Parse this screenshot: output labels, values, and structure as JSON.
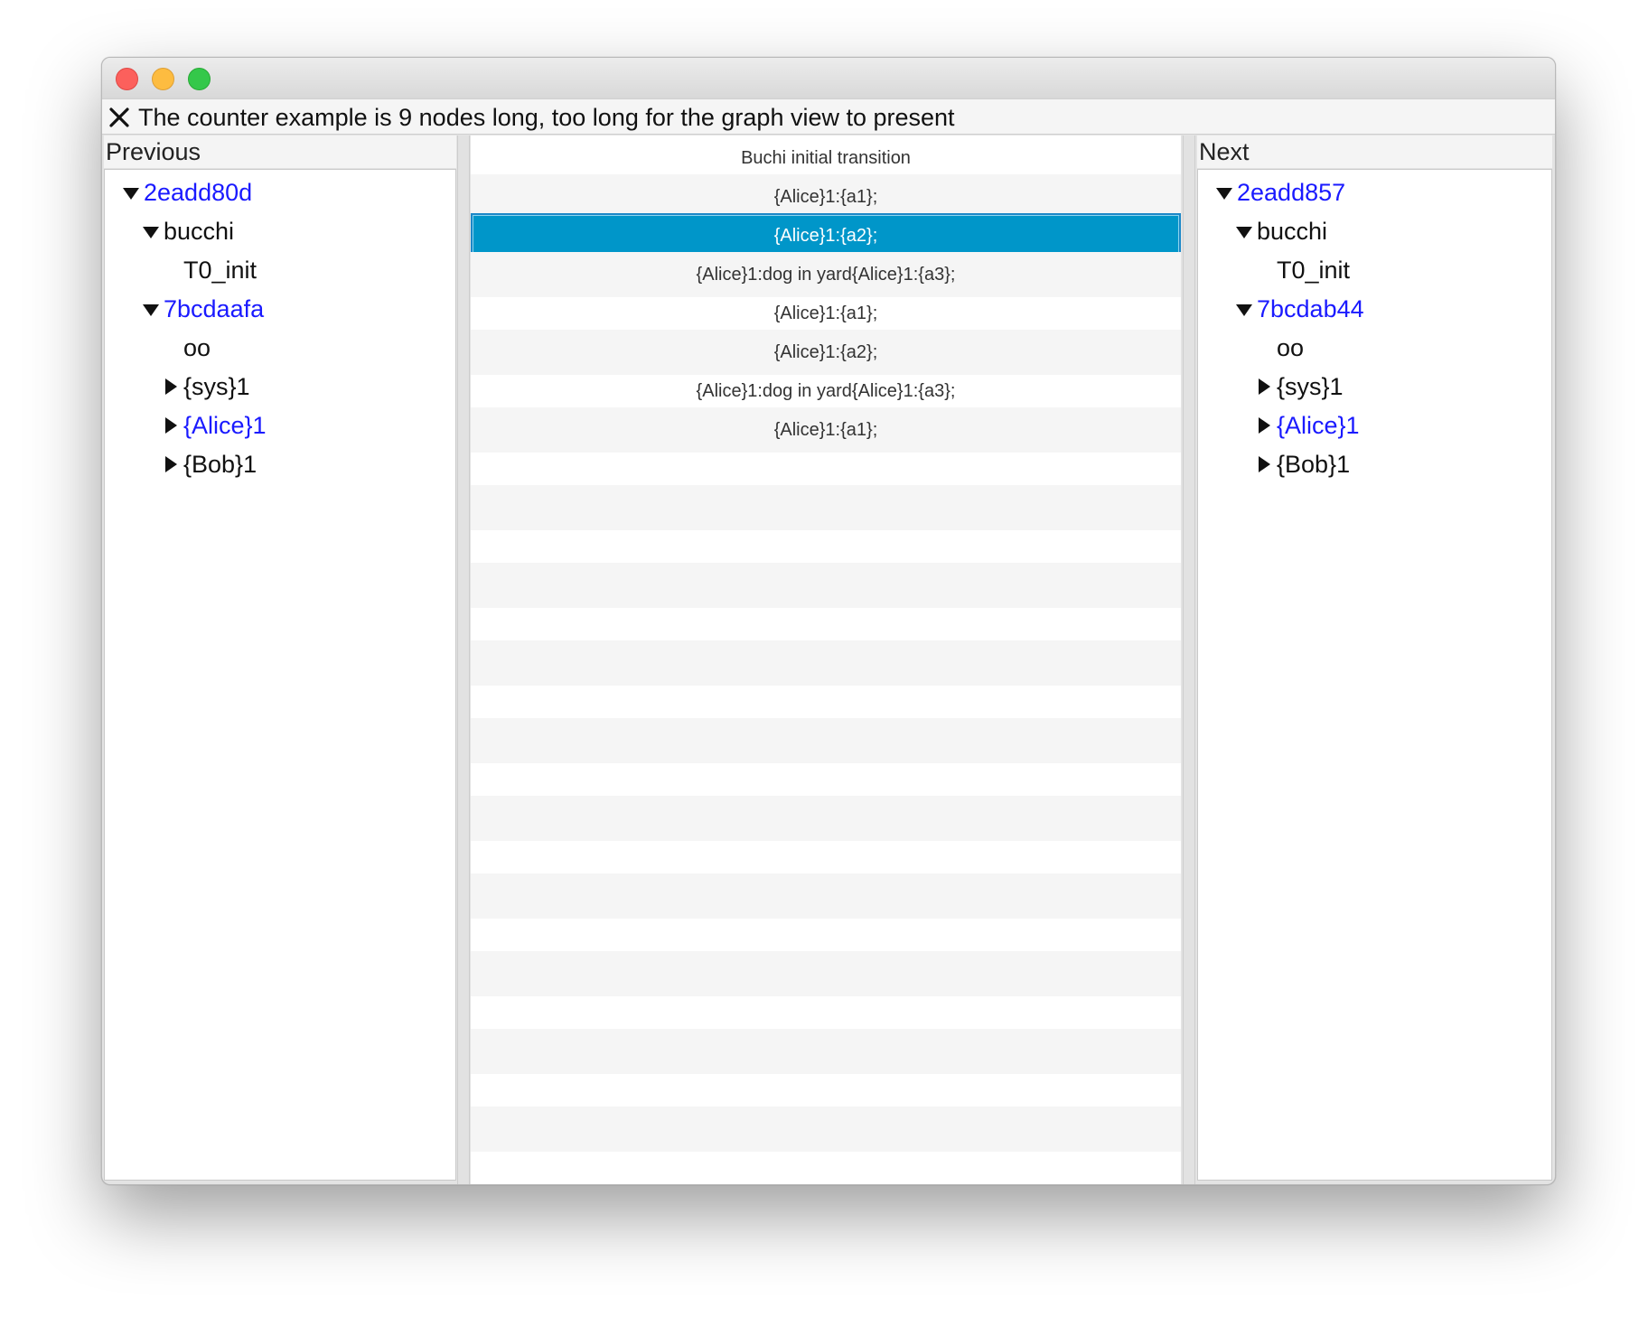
{
  "notice": {
    "message": "The counter example is 9 nodes long, too long for the graph view to present",
    "close_icon": "close-icon"
  },
  "previous": {
    "title": "Previous",
    "nodes": [
      {
        "label": "2eadd80d",
        "expanded": true,
        "link": true
      },
      {
        "label": "bucchi",
        "expanded": true,
        "link": false
      },
      {
        "label": "T0_init",
        "leaf": true,
        "link": false
      },
      {
        "label": "7bcdaafa",
        "expanded": true,
        "link": true
      },
      {
        "label": "oo",
        "leaf": true,
        "link": false
      },
      {
        "label": "{sys}1",
        "expanded": false,
        "link": false
      },
      {
        "label": "{Alice}1",
        "expanded": false,
        "link": true
      },
      {
        "label": "{Bob}1",
        "expanded": false,
        "link": false
      }
    ]
  },
  "next": {
    "title": "Next",
    "nodes": [
      {
        "label": "2eadd857",
        "expanded": true,
        "link": true
      },
      {
        "label": "bucchi",
        "expanded": true,
        "link": false
      },
      {
        "label": "T0_init",
        "leaf": true,
        "link": false
      },
      {
        "label": "7bcdab44",
        "expanded": true,
        "link": true
      },
      {
        "label": "oo",
        "leaf": true,
        "link": false
      },
      {
        "label": "{sys}1",
        "expanded": false,
        "link": false
      },
      {
        "label": "{Alice}1",
        "expanded": false,
        "link": true
      },
      {
        "label": "{Bob}1",
        "expanded": false,
        "link": false
      }
    ]
  },
  "transitions": {
    "rows": [
      "Buchi initial transition",
      "{Alice}1:{a1};",
      "{Alice}1:{a2};",
      "{Alice}1:dog in yard{Alice}1:{a3};",
      "{Alice}1:{a1};",
      "{Alice}1:{a2};",
      "{Alice}1:dog in yard{Alice}1:{a3};",
      "{Alice}1:{a1};"
    ],
    "selected_index": 2
  },
  "colors": {
    "link": "#1a1aff",
    "selection": "#0096c9",
    "stripe": "#f5f5f5"
  }
}
